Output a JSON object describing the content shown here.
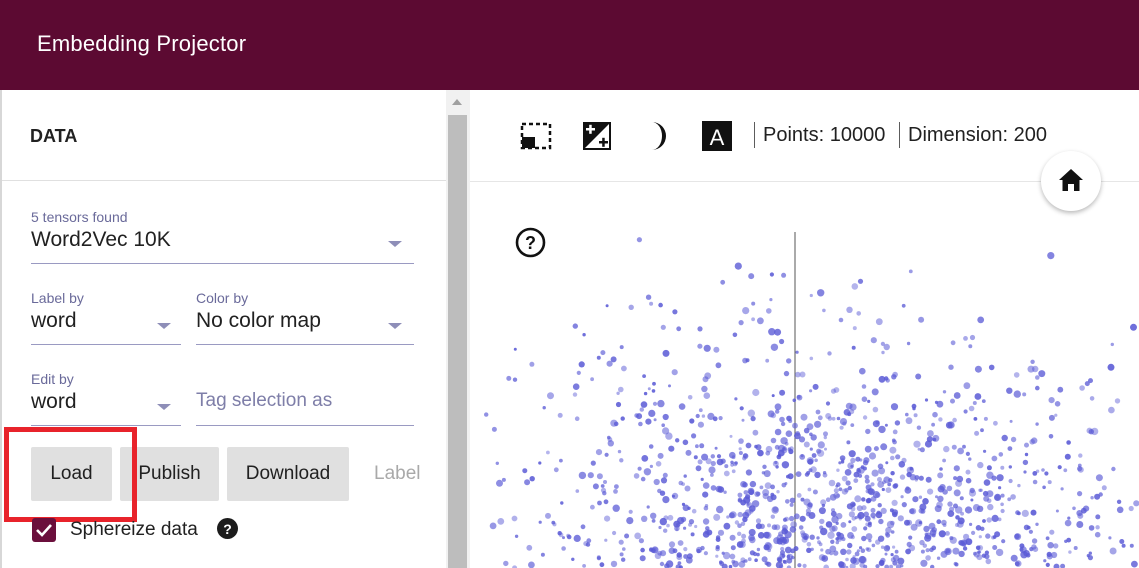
{
  "app": {
    "title": "Embedding Projector"
  },
  "data_panel": {
    "section_title": "DATA",
    "tensor": {
      "label": "5 tensors found",
      "value": "Word2Vec 10K"
    },
    "label_by": {
      "label": "Label by",
      "value": "word"
    },
    "color_by": {
      "label": "Color by",
      "value": "No color map"
    },
    "edit_by": {
      "label": "Edit by",
      "value": "word"
    },
    "tag_selection": {
      "placeholder": "Tag selection as"
    },
    "buttons": {
      "load": "Load",
      "publish": "Publish",
      "download": "Download",
      "label": "Label"
    },
    "sphereize": {
      "label": "Sphereize data",
      "checked": true,
      "help": "?"
    }
  },
  "toolbar": {
    "icons": [
      "select-rectangle-icon",
      "night-mode-icon",
      "moon-icon",
      "label-a-icon"
    ],
    "points_text": "Points: 10000",
    "dimension_text": "Dimension: 200",
    "home_icon": "home-icon",
    "help_icon": "help-icon"
  },
  "colors": {
    "header": "#5c0a32",
    "point": "#5b5bd6",
    "highlight": "#e8232b"
  }
}
